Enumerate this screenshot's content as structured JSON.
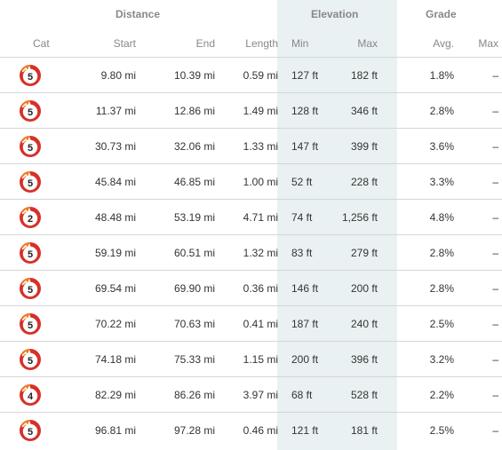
{
  "groups": {
    "distance": "Distance",
    "elevation": "Elevation",
    "grade": "Grade"
  },
  "columns": {
    "cat": "Cat",
    "start": "Start",
    "end": "End",
    "length": "Length",
    "min": "Min",
    "max": "Max",
    "avg": "Avg.",
    "grade_max": "Max"
  },
  "colors": {
    "elevation_band": "#e9f1f2",
    "badge_red": "#d7302a",
    "badge_orange": "#f07a22"
  },
  "rows": [
    {
      "cat": "5",
      "start": "9.80 mi",
      "end": "10.39 mi",
      "length": "0.59 mi",
      "min": "127 ft",
      "max": "182 ft",
      "avg": "1.8%",
      "gmax": "–"
    },
    {
      "cat": "5",
      "start": "11.37 mi",
      "end": "12.86 mi",
      "length": "1.49 mi",
      "min": "128 ft",
      "max": "346 ft",
      "avg": "2.8%",
      "gmax": "–"
    },
    {
      "cat": "5",
      "start": "30.73 mi",
      "end": "32.06 mi",
      "length": "1.33 mi",
      "min": "147 ft",
      "max": "399 ft",
      "avg": "3.6%",
      "gmax": "–"
    },
    {
      "cat": "5",
      "start": "45.84 mi",
      "end": "46.85 mi",
      "length": "1.00 mi",
      "min": "52 ft",
      "max": "228 ft",
      "avg": "3.3%",
      "gmax": "–"
    },
    {
      "cat": "2",
      "start": "48.48 mi",
      "end": "53.19 mi",
      "length": "4.71 mi",
      "min": "74 ft",
      "max": "1,256 ft",
      "avg": "4.8%",
      "gmax": "–"
    },
    {
      "cat": "5",
      "start": "59.19 mi",
      "end": "60.51 mi",
      "length": "1.32 mi",
      "min": "83 ft",
      "max": "279 ft",
      "avg": "2.8%",
      "gmax": "–"
    },
    {
      "cat": "5",
      "start": "69.54 mi",
      "end": "69.90 mi",
      "length": "0.36 mi",
      "min": "146 ft",
      "max": "200 ft",
      "avg": "2.8%",
      "gmax": "–"
    },
    {
      "cat": "5",
      "start": "70.22 mi",
      "end": "70.63 mi",
      "length": "0.41 mi",
      "min": "187 ft",
      "max": "240 ft",
      "avg": "2.5%",
      "gmax": "–"
    },
    {
      "cat": "5",
      "start": "74.18 mi",
      "end": "75.33 mi",
      "length": "1.15 mi",
      "min": "200 ft",
      "max": "396 ft",
      "avg": "3.2%",
      "gmax": "–"
    },
    {
      "cat": "4",
      "start": "82.29 mi",
      "end": "86.26 mi",
      "length": "3.97 mi",
      "min": "68 ft",
      "max": "528 ft",
      "avg": "2.2%",
      "gmax": "–"
    },
    {
      "cat": "5",
      "start": "96.81 mi",
      "end": "97.28 mi",
      "length": "0.46 mi",
      "min": "121 ft",
      "max": "181 ft",
      "avg": "2.5%",
      "gmax": "–"
    }
  ]
}
